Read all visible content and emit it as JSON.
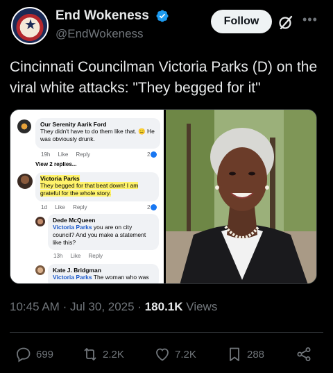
{
  "author": {
    "display_name": "End Wokeness",
    "handle": "@EndWokeness",
    "avatar_label": "SUPPORT THE HUMAN THINGS"
  },
  "follow_label": "Follow",
  "tweet_text": "Cincinnati Councilman Victoria Parks (D) on the viral white attacks: \"They begged for it\"",
  "screenshot": {
    "comment1": {
      "name": "Our Serenity Aarik Ford",
      "text": "They didn't have to do them like that. 😑 He was obviously drunk.",
      "time": "19h",
      "like": "Like",
      "reply": "Reply",
      "count": "2",
      "view_replies": "View 2 replies..."
    },
    "comment2": {
      "name": "Victoria Parks",
      "text": "They begged for that beat down! I am grateful for the whole story.",
      "time": "1d",
      "like": "Like",
      "reply": "Reply",
      "count": "2"
    },
    "comment3": {
      "name": "Dede McQueen",
      "mention": "Victoria Parks",
      "text": " you are on city council? And you make a statement like this?",
      "time": "13h",
      "like": "Like",
      "reply": "Reply"
    },
    "comment4": {
      "name": "Kate J. Bridgman",
      "mention": "Victoria Parks",
      "text": " The woman who was"
    }
  },
  "timestamp": {
    "time": "10:45 AM",
    "date": "Jul 30, 2025",
    "views_count": "180.1K",
    "views_label": "Views"
  },
  "actions": {
    "replies": "699",
    "reposts": "2.2K",
    "likes": "7.2K",
    "bookmarks": "288"
  },
  "colors": {
    "background": "#000000",
    "text": "#e7e9ea",
    "muted": "#71767b",
    "verified": "#1d9bf0",
    "highlight": "#fff36b"
  }
}
